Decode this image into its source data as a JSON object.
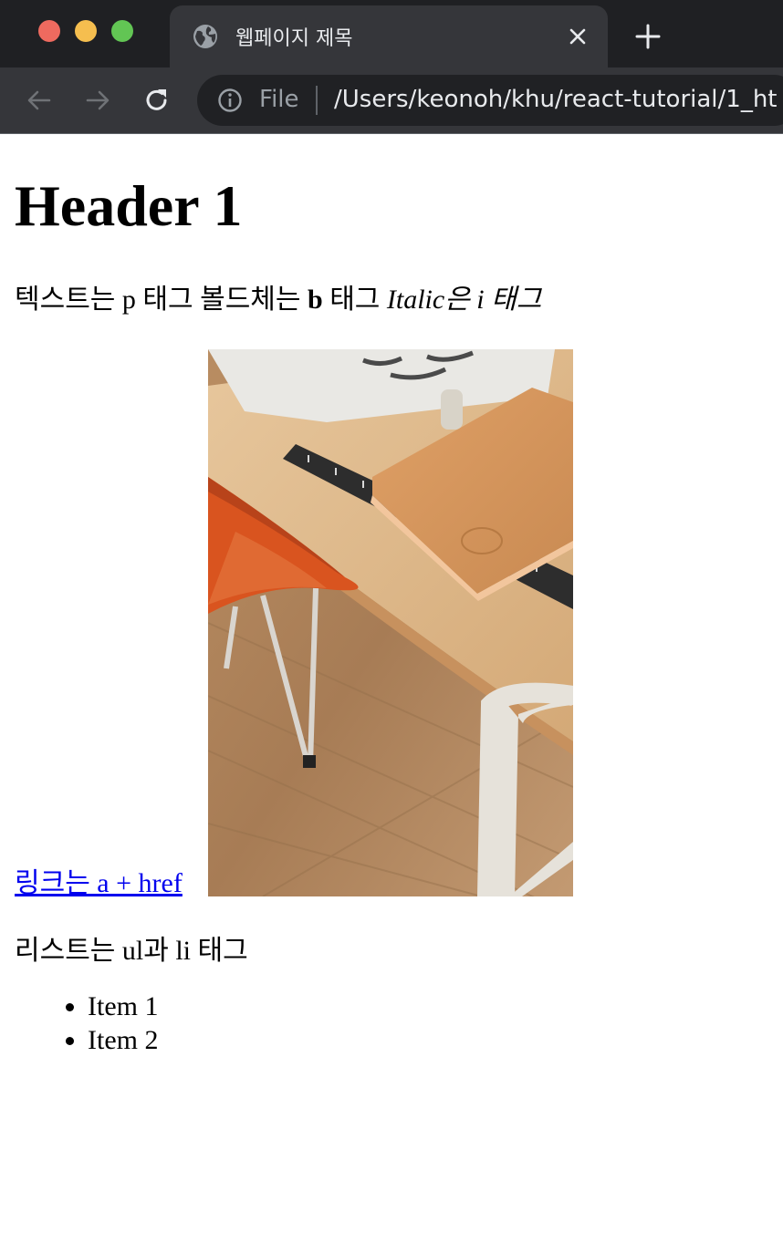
{
  "window": {
    "traffic_lights": [
      "close",
      "minimize",
      "zoom"
    ],
    "colors": {
      "close": "#ee6a5f",
      "minimize": "#f5be4f",
      "zoom": "#62c554"
    }
  },
  "tab": {
    "title": "웹페이지 제목",
    "favicon": "globe-icon"
  },
  "toolbar": {
    "scheme_label": "File",
    "url": "/Users/keonoh/khu/react-tutorial/1_ht"
  },
  "content": {
    "heading": "Header 1",
    "paragraph1": {
      "part1": "텍스트는 p 태그 볼드체는 ",
      "bold": "b",
      "part2": " 태그 ",
      "italic": "Italic은 i 태그"
    },
    "link_text": "링크는 a + href",
    "image": {
      "subject": "wooden desk with leather notebook, ruler, paper and orange chair on wooden floor"
    },
    "paragraph2": "리스트는 ul과 li 태그",
    "list_items": [
      "Item 1",
      "Item 2"
    ]
  }
}
